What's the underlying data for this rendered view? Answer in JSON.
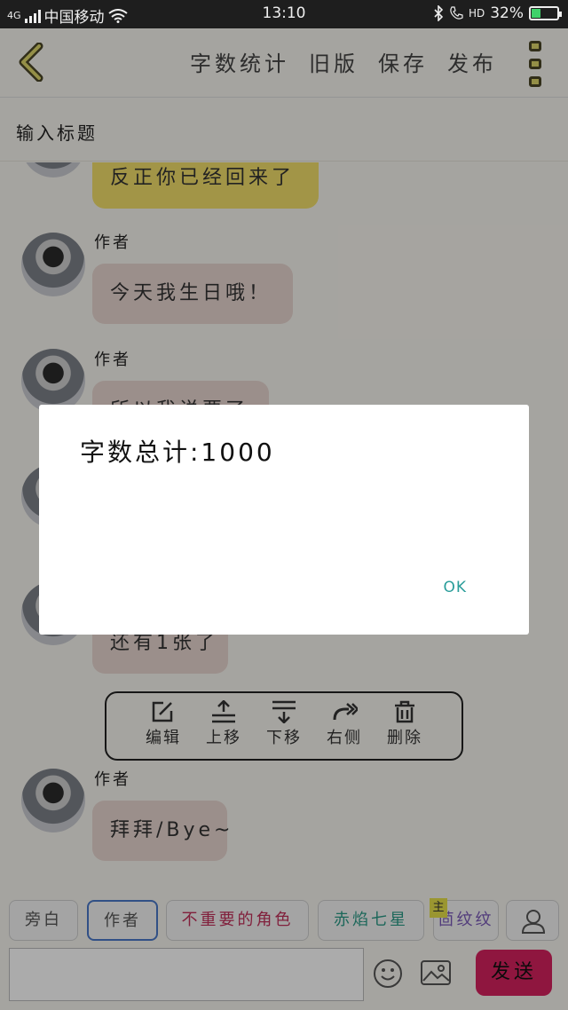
{
  "status_bar": {
    "network": "4G",
    "carrier": "中国移动",
    "time": "13:10",
    "hd": "HD",
    "battery": "32%",
    "battery_level": 0.32
  },
  "header": {
    "actions": [
      "字数统计",
      "旧版",
      "保存",
      "发布"
    ]
  },
  "title_field": {
    "placeholder": "输入标题"
  },
  "messages": [
    {
      "text": "反正你已经回来了",
      "color": "#f2df6b"
    },
    {
      "sender": "作者",
      "text": "今天我生日哦！"
    },
    {
      "sender": "作者",
      "text": "所以我说要了"
    },
    {
      "text": "还有1张了"
    },
    {
      "sender": "作者",
      "text": "拜拜/Bye~"
    }
  ],
  "toolbar": {
    "items": [
      {
        "label": "编辑",
        "icon": "edit-icon"
      },
      {
        "label": "上移",
        "icon": "move-up-icon"
      },
      {
        "label": "下移",
        "icon": "move-down-icon"
      },
      {
        "label": "右侧",
        "icon": "redo-arrow-icon"
      },
      {
        "label": "删除",
        "icon": "trash-icon"
      }
    ]
  },
  "roles": [
    {
      "label": "旁白",
      "color": "#555555"
    },
    {
      "label": "作者",
      "color": "#555555",
      "active": true
    },
    {
      "label": "不重要的角色",
      "color": "#c0305a"
    },
    {
      "label": "赤焰七星",
      "color": "#2a9a86"
    },
    {
      "label": "茴纹纹",
      "color": "#7a58b8",
      "badge": "主"
    }
  ],
  "send_label": "发送",
  "dialog": {
    "message": "字数总计:1000",
    "ok_label": "OK"
  },
  "colors": {
    "accent_send": "#d6225e",
    "dialog_ok": "#2a9d9a"
  }
}
